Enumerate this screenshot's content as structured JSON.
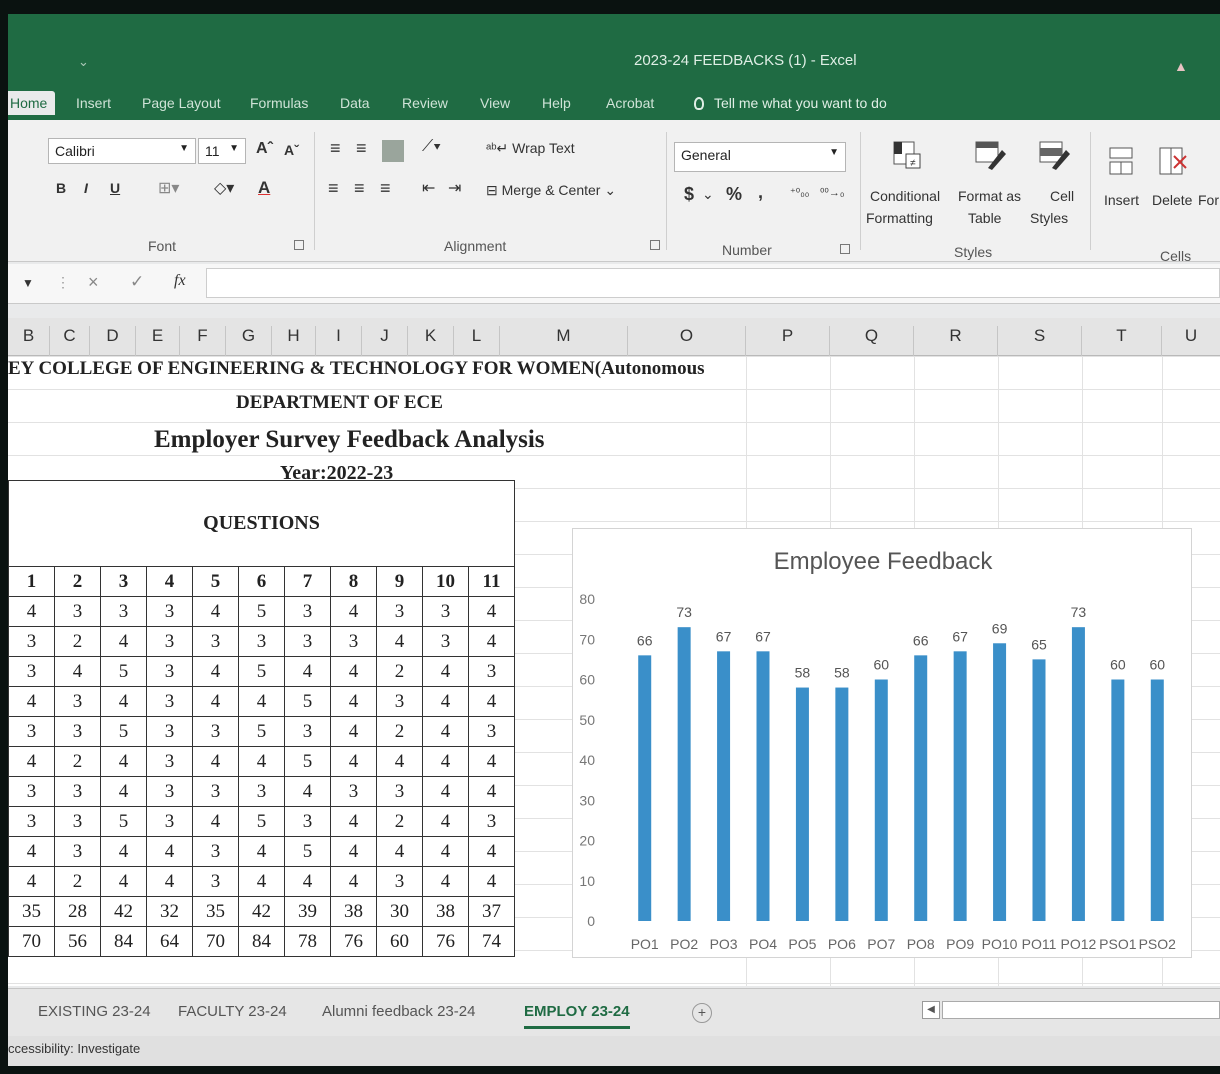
{
  "window": {
    "title": "2023-24 FEEDBACKS (1)  -  Excel"
  },
  "menu_tabs": [
    "Home",
    "Insert",
    "Page Layout",
    "Formulas",
    "Data",
    "Review",
    "View",
    "Help",
    "Acrobat"
  ],
  "tell_me": "Tell me what you want to do",
  "ribbon": {
    "font_name": "Calibri",
    "font_size": "11",
    "bold": "B",
    "italic": "I",
    "underline": "U",
    "font_group": "Font",
    "wrap_text": "Wrap Text",
    "merge_center": "Merge & Center",
    "alignment_group": "Alignment",
    "number_format": "General",
    "currency": "$",
    "percent": "%",
    "comma": ",",
    "number_group": "Number",
    "conditional_formatting": [
      "Conditional",
      "Formatting"
    ],
    "format_as_table": [
      "Format as",
      "Table"
    ],
    "cell_styles": [
      "Cell",
      "Styles"
    ],
    "styles_group": "Styles",
    "insert": "Insert",
    "delete": "Delete",
    "format": "For",
    "cells_group": "Cells"
  },
  "formula_bar": {
    "cancel": "×",
    "enter": "✓",
    "fx": "fx"
  },
  "columns": [
    "B",
    "C",
    "D",
    "E",
    "F",
    "G",
    "H",
    "I",
    "J",
    "K",
    "L",
    "M",
    "O",
    "P",
    "Q",
    "R",
    "S",
    "T",
    "U"
  ],
  "sheet": {
    "college": "EY COLLEGE OF ENGINEERING & TECHNOLOGY FOR WOMEN(Autonomous",
    "department": "DEPARTMENT OF ECE",
    "survey_title": "Employer Survey Feedback Analysis",
    "year": "Year:2022-23",
    "questions_label": "QUESTIONS",
    "question_numbers": [
      "1",
      "2",
      "3",
      "4",
      "5",
      "6",
      "7",
      "8",
      "9",
      "10",
      "11"
    ],
    "rows": [
      [
        "4",
        "3",
        "3",
        "3",
        "4",
        "5",
        "3",
        "4",
        "3",
        "3",
        "4"
      ],
      [
        "3",
        "2",
        "4",
        "3",
        "3",
        "3",
        "3",
        "3",
        "4",
        "3",
        "4"
      ],
      [
        "3",
        "4",
        "5",
        "3",
        "4",
        "5",
        "4",
        "4",
        "2",
        "4",
        "3"
      ],
      [
        "4",
        "3",
        "4",
        "3",
        "4",
        "4",
        "5",
        "4",
        "3",
        "4",
        "4"
      ],
      [
        "3",
        "3",
        "5",
        "3",
        "3",
        "5",
        "3",
        "4",
        "2",
        "4",
        "3"
      ],
      [
        "4",
        "2",
        "4",
        "3",
        "4",
        "4",
        "5",
        "4",
        "4",
        "4",
        "4"
      ],
      [
        "3",
        "3",
        "4",
        "3",
        "3",
        "3",
        "4",
        "3",
        "3",
        "4",
        "4"
      ],
      [
        "3",
        "3",
        "5",
        "3",
        "4",
        "5",
        "3",
        "4",
        "2",
        "4",
        "3"
      ],
      [
        "4",
        "3",
        "4",
        "4",
        "3",
        "4",
        "5",
        "4",
        "4",
        "4",
        "4"
      ],
      [
        "4",
        "2",
        "4",
        "4",
        "3",
        "4",
        "4",
        "4",
        "3",
        "4",
        "4"
      ]
    ],
    "totals": [
      "35",
      "28",
      "42",
      "32",
      "35",
      "42",
      "39",
      "38",
      "30",
      "38",
      "37"
    ],
    "percentages": [
      "70",
      "56",
      "84",
      "64",
      "70",
      "84",
      "78",
      "76",
      "60",
      "76",
      "74"
    ]
  },
  "chart_data": {
    "type": "bar",
    "title": "Employee Feedback",
    "categories": [
      "PO1",
      "PO2",
      "PO3",
      "PO4",
      "PO5",
      "PO6",
      "PO7",
      "PO8",
      "PO9",
      "PO10",
      "PO11",
      "PO12",
      "PSO1",
      "PSO2"
    ],
    "values": [
      66,
      73,
      67,
      67,
      58,
      58,
      60,
      66,
      67,
      69,
      65,
      73,
      60,
      60
    ],
    "ylim": [
      0,
      80
    ],
    "yticks": [
      0,
      10,
      20,
      30,
      40,
      50,
      60,
      70,
      80
    ],
    "xlabel": "",
    "ylabel": "",
    "grid": false,
    "bar_color": "#3a8fc9"
  },
  "sheet_tabs": [
    "EXISTING 23-24",
    "FACULTY 23-24",
    "Alumni feedback 23-24",
    "EMPLOY 23-24"
  ],
  "active_sheet_tab": "EMPLOY 23-24",
  "add_sheet": "+",
  "status": "ccessibility: Investigate"
}
